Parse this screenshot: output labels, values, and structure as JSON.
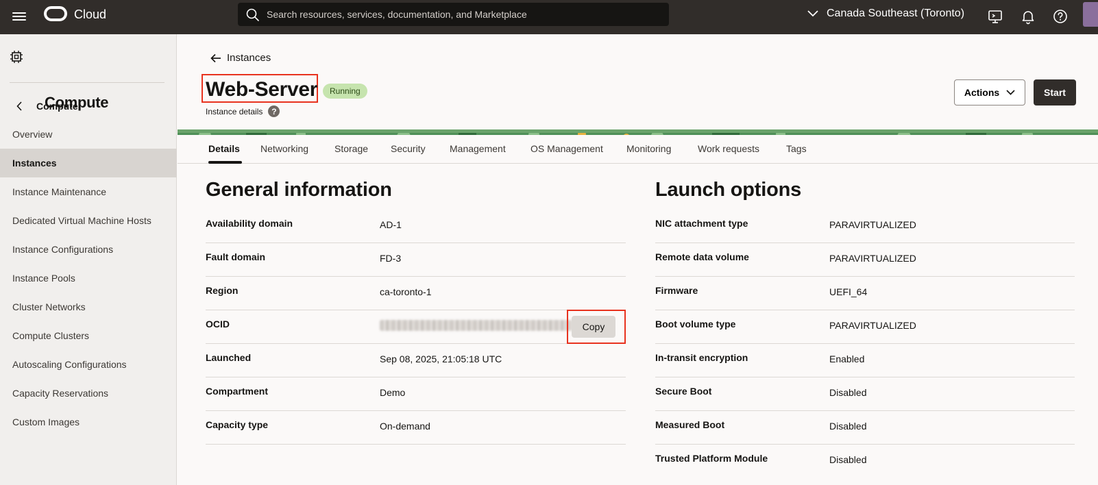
{
  "topbar": {
    "brand": "Cloud",
    "search_placeholder": "Search resources, services, documentation, and Marketplace",
    "region": "Canada Southeast (Toronto)"
  },
  "sidebar": {
    "title": "Compute",
    "back_label": "Compute",
    "items": [
      {
        "label": "Overview"
      },
      {
        "label": "Instances",
        "active": true
      },
      {
        "label": "Instance Maintenance"
      },
      {
        "label": "Dedicated Virtual Machine Hosts"
      },
      {
        "label": "Instance Configurations"
      },
      {
        "label": "Instance Pools"
      },
      {
        "label": "Cluster Networks"
      },
      {
        "label": "Compute Clusters"
      },
      {
        "label": "Autoscaling Configurations"
      },
      {
        "label": "Capacity Reservations"
      },
      {
        "label": "Custom Images"
      }
    ]
  },
  "header": {
    "breadcrumb": "Instances",
    "title": "Web-Server",
    "status": "Running",
    "subtitle": "Instance details",
    "actions_label": "Actions",
    "start_label": "Start"
  },
  "tabs": [
    "Details",
    "Networking",
    "Storage",
    "Security",
    "Management",
    "OS Management",
    "Monitoring",
    "Work requests",
    "Tags"
  ],
  "general": {
    "title": "General information",
    "rows": [
      {
        "key": "Availability domain",
        "value": "AD-1"
      },
      {
        "key": "Fault domain",
        "value": "FD-3"
      },
      {
        "key": "Region",
        "value": "ca-toronto-1"
      },
      {
        "key": "OCID",
        "value": ""
      },
      {
        "key": "Launched",
        "value": "Sep 08, 2025, 21:05:18 UTC"
      },
      {
        "key": "Compartment",
        "value": "Demo"
      },
      {
        "key": "Capacity type",
        "value": "On-demand"
      }
    ],
    "copy_label": "Copy"
  },
  "launch": {
    "title": "Launch options",
    "rows": [
      {
        "key": "NIC attachment type",
        "value": "PARAVIRTUALIZED"
      },
      {
        "key": "Remote data volume",
        "value": "PARAVIRTUALIZED"
      },
      {
        "key": "Firmware",
        "value": "UEFI_64"
      },
      {
        "key": "Boot volume type",
        "value": "PARAVIRTUALIZED"
      },
      {
        "key": "In-transit encryption",
        "value": "Enabled"
      },
      {
        "key": "Secure Boot",
        "value": "Disabled"
      },
      {
        "key": "Measured Boot",
        "value": "Disabled"
      },
      {
        "key": "Trusted Platform Module",
        "value": "Disabled"
      }
    ]
  },
  "colors": {
    "topbar": "#312d2a",
    "highlight": "#e8321e",
    "status_badge": "#c6e4ae"
  }
}
